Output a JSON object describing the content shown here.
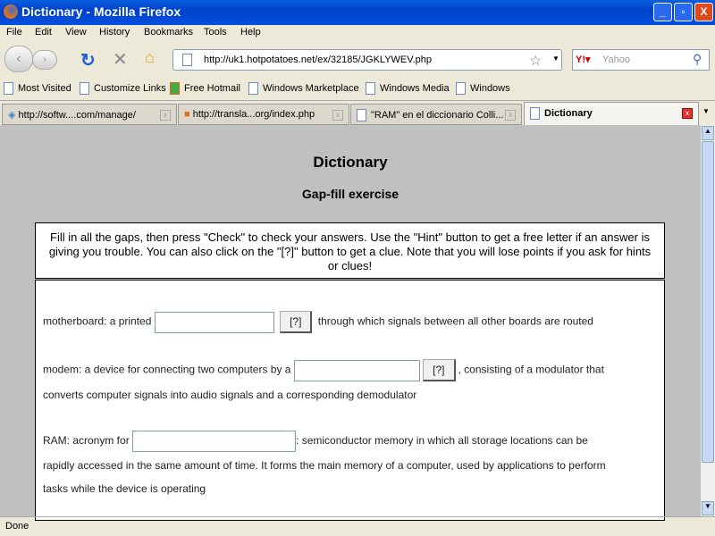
{
  "window": {
    "title": "Dictionary - Mozilla Firefox",
    "minimize": "_",
    "maximize": "▫",
    "close": "X"
  },
  "menu": [
    "File",
    "Edit",
    "View",
    "History",
    "Bookmarks",
    "Tools",
    "Help"
  ],
  "nav": {
    "url": "http://uk1.hotpotatoes.net/ex/32185/JGKLYWEV.php",
    "search_placeholder": "Yahoo"
  },
  "bookmarks": [
    "Most Visited",
    "Customize Links",
    "Free Hotmail",
    "Windows Marketplace",
    "Windows Media",
    "Windows"
  ],
  "tabs": [
    {
      "label": "http://softw....com/manage/"
    },
    {
      "label": "http://transla...org/index.php"
    },
    {
      "label": "\"RAM\" en el diccionario Colli..."
    },
    {
      "label": "Dictionary",
      "active": true
    }
  ],
  "page": {
    "title": "Dictionary",
    "subtitle": "Gap-fill exercise",
    "instructions": "Fill in all the gaps, then press \"Check\" to check your answers. Use the \"Hint\" button to get a free letter if an answer is giving you trouble. You can also click on the \"[?]\" button to get a clue. Note that you will lose points if you ask for hints or clues!",
    "items": [
      {
        "before": "motherboard: a printed",
        "hint": "[?]",
        "after": "through which signals between all other boards are routed"
      },
      {
        "before": "modem: a device for connecting two computers by a",
        "hint": "[?]",
        "after": ", consisting of a modulator that",
        "after2": "converts computer signals into audio signals and a corresponding demodulator"
      },
      {
        "before": "RAM: acronym for",
        "after": ": semiconductor memory in which all storage locations can be",
        "after2": "rapidly accessed in the same amount of time. It forms the main memory of a computer, used by applications to perform",
        "after3": "tasks while the device is operating"
      }
    ]
  },
  "status": "Done"
}
